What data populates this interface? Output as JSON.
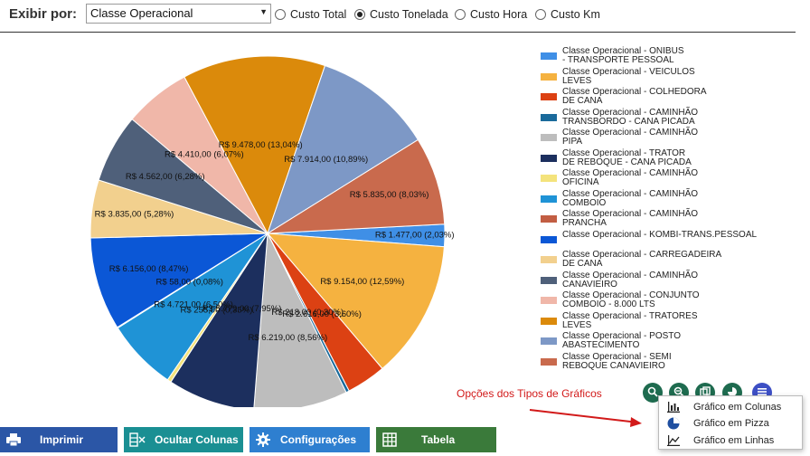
{
  "filter": {
    "exibir_label": "Exibir por:",
    "select_value": "Classe Operacional",
    "radios": [
      {
        "label": "Custo Total",
        "selected": false
      },
      {
        "label": "Custo Tonelada",
        "selected": true
      },
      {
        "label": "Custo Hora",
        "selected": false
      },
      {
        "label": "Custo Km",
        "selected": false
      }
    ]
  },
  "chart_data": {
    "type": "pie",
    "series": [
      {
        "name": "Classe Operacional - ONIBUS - TRANSPORTE PESSOAL",
        "value": 1477.0,
        "label": "R$ 1.477,00  (2,03%)",
        "color": "#3f8fe6"
      },
      {
        "name": "Classe Operacional - VEICULOS LEVES",
        "value": 9154.0,
        "label": "R$ 9.154,00  (12,59%)",
        "color": "#f5b240"
      },
      {
        "name": "Classe Operacional - COLHEDORA DE CANA",
        "value": 2616.0,
        "label": "R$ 2.616,00  (3,60%)",
        "color": "#dc4113"
      },
      {
        "name": "Classe Operacional - CAMINHÃO TRANSBORDO - CANA PICADA",
        "value": 218.0,
        "label": "R$ 218,00  (0,30%)",
        "color": "#1a6a9b"
      },
      {
        "name": "Classe Operacional - CAMINHÃO PIPA",
        "value": 6219.0,
        "label": "R$ 6.219,00  (8,56%)",
        "color": "#bdbdbd"
      },
      {
        "name": "Classe Operacional - TRATOR DE REBOQUE - CANA PICADA",
        "value": 5779.0,
        "label": "R$ 5.779,00  (7,95%)",
        "color": "#1c2f5e"
      },
      {
        "name": "Classe Operacional - CAMINHÃO OFICINA",
        "value": 255.0,
        "label": "R$ 255,00  (0,35%)",
        "color": "#f4e37c"
      },
      {
        "name": "Classe Operacional - CAMINHÃO COMBOIO",
        "value": 4721.0,
        "label": "R$ 4.721,00  (6,50%)",
        "color": "#1f93d6"
      },
      {
        "name": "Classe Operacional - CAMINHÃO PRANCHA",
        "value": 58.0,
        "label": "R$ 58,00  (0,08%)",
        "color": "#c25e43"
      },
      {
        "name": "Classe Operacional - KOMBI-TRANS.PESSOAL",
        "value": 6156.0,
        "label": "R$ 6.156,00  (8,47%)",
        "color": "#0b57d6"
      },
      {
        "name": "Classe Operacional - CARREGADEIRA DE CANA",
        "value": 3835.0,
        "label": "R$ 3.835,00  (5,28%)",
        "color": "#f2d08e"
      },
      {
        "name": "Classe Operacional - CAMINHÃO CANAVIEIRO",
        "value": 4562.0,
        "label": "R$ 4.562,00  (6,28%)",
        "color": "#4f607a"
      },
      {
        "name": "Classe Operacional - CONJUNTO COMBOIO - 8.000 LTS",
        "value": 4410.0,
        "label": "R$ 4.410,00  (6,07%)",
        "color": "#f0b7a9"
      },
      {
        "name": "Classe Operacional - TRATORES LEVES",
        "value": 9478.0,
        "label": "R$ 9.478,00  (13,04%)",
        "color": "#db8a0b"
      },
      {
        "name": "Classe Operacional - POSTO ABASTECIMENTO",
        "value": 7914.0,
        "label": "R$ 7.914,00  (10,89%)",
        "color": "#7d98c6"
      },
      {
        "name": "Classe Operacional - SEMI REBOQUE CANAVIEIRO",
        "value": 5835.0,
        "label": "R$ 5.835,00  (8,03%)",
        "color": "#c96a4d"
      }
    ],
    "legend_lines": [
      "Classe Operacional - ONIBUS\n- TRANSPORTE PESSOAL",
      "Classe Operacional - VEICULOS\nLEVES",
      "Classe Operacional - COLHEDORA\nDE CANA",
      "Classe Operacional - CAMINHÃO\nTRANSBORDO - CANA PICADA",
      "Classe Operacional - CAMINHÃO\nPIPA",
      "Classe Operacional - TRATOR\nDE REBOQUE - CANA PICADA",
      "Classe Operacional - CAMINHÃO\nOFICINA",
      "Classe Operacional - CAMINHÃO\nCOMBOIO",
      "Classe Operacional - CAMINHÃO\nPRANCHA",
      "Classe Operacional - KOMBI-TRANS.PESSOAL",
      "Classe Operacional - CARREGADEIRA\nDE CANA",
      "Classe Operacional - CAMINHÃO\nCANAVIEIRO",
      "Classe Operacional - CONJUNTO\nCOMBOIO - 8.000 LTS",
      "Classe Operacional - TRATORES\nLEVES",
      "Classe Operacional - POSTO\nABASTECIMENTO",
      "Classe Operacional - SEMI\nREBOQUE CANAVIEIRO"
    ],
    "legend_placement": "right"
  },
  "chart_options": {
    "annotation": "Opções dos Tipos de Gráficos",
    "buttons": [
      {
        "icon": "zoom-in-icon",
        "color": "#1e6b4f"
      },
      {
        "icon": "zoom-out-icon",
        "color": "#1e6b4f"
      },
      {
        "icon": "copy-icon",
        "color": "#1e6b4f"
      },
      {
        "icon": "chart-type-icon",
        "color": "#1e6b4f"
      },
      {
        "icon": "menu-icon",
        "color": "#3d4fc4"
      }
    ],
    "menu": [
      {
        "label": "Gráfico em Colunas",
        "icon": "column-chart-icon"
      },
      {
        "label": "Gráfico em Pizza",
        "icon": "pie-chart-icon"
      },
      {
        "label": "Gráfico em Linhas",
        "icon": "line-chart-icon"
      }
    ]
  },
  "toolbar": {
    "print_label": "Imprimir",
    "hide_columns_label": "Ocultar Colunas",
    "settings_label": "Configurações",
    "table_label": "Tabela",
    "colors": {
      "print": "#2b56a6",
      "hide": "#1a8f93",
      "settings": "#2e7fd0",
      "table": "#3a7a3a"
    }
  }
}
